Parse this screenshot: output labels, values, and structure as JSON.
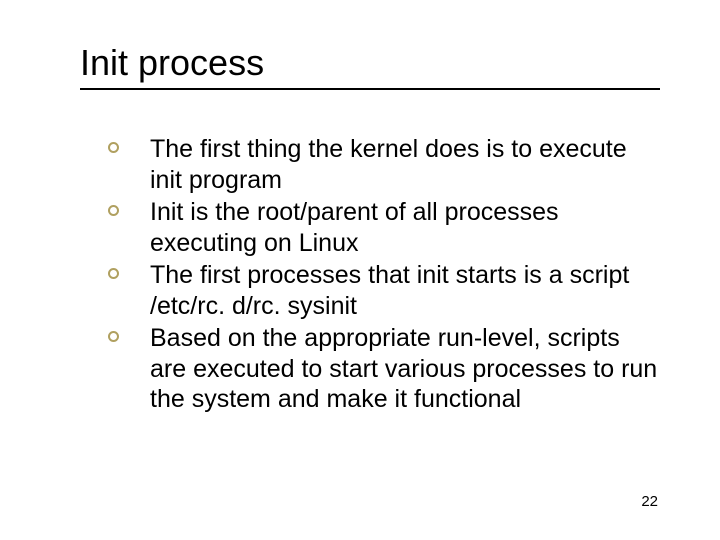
{
  "title": "Init process",
  "bullets": [
    "The first thing the kernel does is to execute init program",
    "Init is the root/parent of all processes executing on Linux",
    "The first processes that init starts is a script /etc/rc. d/rc. sysinit",
    "Based on the appropriate run-level, scripts are executed to start various processes to run the system and make it functional"
  ],
  "page_number": "22"
}
